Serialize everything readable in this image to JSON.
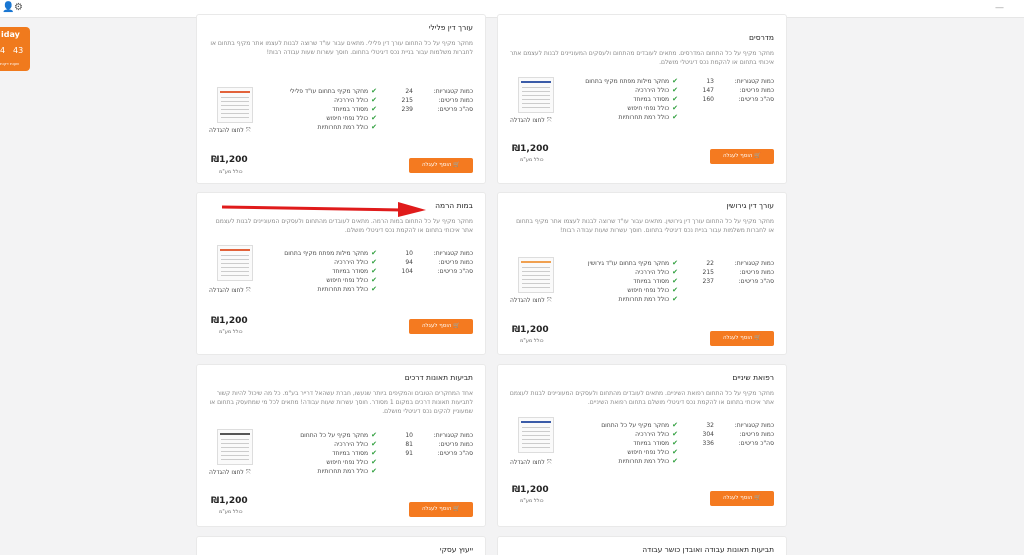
{
  "topbar": {
    "icon_left": "user-icon",
    "icon_settings": "gear-icon",
    "dash": "—"
  },
  "friday": {
    "day": "iday",
    "num1": "4",
    "num2": "43",
    "labels": "שעות   דקות"
  },
  "common": {
    "cart_label": "🛒 הוסף לעגלה",
    "zoom_label": "לחצו להגדלה",
    "price": "₪1,200",
    "unit": "כולל מע\"מ"
  },
  "cards": [
    {
      "title": "עורך דין פלילי",
      "desc": "מחקר מקיף על כל התחום עורך דין פלילי. מתאים עבור עו\"ד שרוצה לבנות לעצמו אתר מקיף בתחום או לחברות משלמות עבור בניית נכס דיגיטלי בתחום. חוסך עשרות שעות עבודה רבות!",
      "stats": [
        {
          "k": "כמות קטגוריות:",
          "v": "24"
        },
        {
          "k": "כמות פריטים:",
          "v": "215"
        },
        {
          "k": "סה\"כ פריטים:",
          "v": "239"
        }
      ],
      "features": [
        "מחקר מקיף בתחום עו\"ד פלילי",
        "כולל היררכיה",
        "מסודר במיוחד",
        "כולל נפחי חיפוש",
        "כולל רמת תחרותיות"
      ]
    },
    {
      "title": "מדרסים",
      "desc": "מחקר מקיף על כל התחום המדרסים. מתאים לעובדים מהתחום ולעסקים המעוניינים לבנות לעצמם אתר איכותי בתחום או להקמת נכס דיגיטלי מושלם.",
      "stats": [
        {
          "k": "כמות קטגוריות:",
          "v": "13"
        },
        {
          "k": "כמות פריטים:",
          "v": "147"
        },
        {
          "k": "סה\"כ פריטים:",
          "v": "160"
        }
      ],
      "features": [
        "מחקר מילות מפתח מקיף בתחום",
        "כולל היררכיה",
        "מסודר במיוחד",
        "כולל נפחי חיפוש",
        "כולל רמת תחרותיות"
      ]
    },
    {
      "title": "במות הרמה",
      "desc": "מחקר מקיף על כל התחום במות הרמה. מתאים לעובדים מהתחום ולעסקים המעוניינים לבנות לעצמם אתר איכותי בתחום או להקמת נכס דיגיטלי מושלם.",
      "stats": [
        {
          "k": "כמות קטגוריות:",
          "v": "10"
        },
        {
          "k": "כמות פריטים:",
          "v": "94"
        },
        {
          "k": "סה\"כ פריטים:",
          "v": "104"
        }
      ],
      "features": [
        "מחקר מילות מפתח מקיף בתחום",
        "כולל היררכיה",
        "מסודר במיוחד",
        "כולל נפחי חיפוש",
        "כולל רמת תחרותיות"
      ]
    },
    {
      "title": "עורך דין גירושין",
      "desc": "מחקר מקיף על כל התחום עורך דין גירושין. מתאים עבור עו\"ד שרוצה לבנות לעצמו אתר מקיף בתחום או לחברות משלמות עבור בניית נכס דיגיטלי בתחום. חוסך עשרות שעות עבודה רבות!",
      "stats": [
        {
          "k": "כמות קטגוריות:",
          "v": "22"
        },
        {
          "k": "כמות פריטים:",
          "v": "215"
        },
        {
          "k": "סה\"כ פריטים:",
          "v": "237"
        }
      ],
      "features": [
        "מחקר מקיף בתחום עו\"ד גירושין",
        "כולל היררכיה",
        "מסודר במיוחד",
        "כולל נפחי חיפוש",
        "כולל רמת תחרותיות"
      ]
    },
    {
      "title": "תביעות תאונות דרכים",
      "desc": "אחד המחקרים הטובים והמקיפים ביותר שנעשו, חברת עשהאל דרייר בע\"מ. כל מה שיכול להיות קשור לתביעות תאונות דרכים במקום 1 מסודר. חוסך עשרות שעות עבודה! מתאים לכל מי שמתעסק בתחום או שמעוניין להקים נכס דיגיטלי מושלם.",
      "stats": [
        {
          "k": "כמות קטגוריות:",
          "v": "10"
        },
        {
          "k": "כמות פריטים:",
          "v": "81"
        },
        {
          "k": "סה\"כ פריטים:",
          "v": "91"
        }
      ],
      "features": [
        "מחקר מקיף על כל התחום",
        "כולל היררכיה",
        "מסודר במיוחד",
        "כולל נפחי חיפוש",
        "כולל רמת תחרותיות"
      ]
    },
    {
      "title": "רפואת שיניים",
      "desc": "מחקר מקיף על כל התחום רפואת השיניים. מתאים לעובדים מהתחום ולעסקים המעוניינים לבנות לעצמם אתר איכותי בתחום או להקמת נכס דיגיטלי מושלם בתחום רפואת השיניים.",
      "stats": [
        {
          "k": "כמות קטגוריות:",
          "v": "32"
        },
        {
          "k": "כמות פריטים:",
          "v": "304"
        },
        {
          "k": "סה\"כ פריטים:",
          "v": "336"
        }
      ],
      "features": [
        "מחקר מקיף על כל התחום",
        "כולל היררכיה",
        "מסודר במיוחד",
        "כולל נפחי חיפוש",
        "כולל רמת תחרותיות"
      ]
    },
    {
      "title": "ייעוץ עסקי"
    },
    {
      "title": "תביעות תאונות עבודה ואובדן כושר עבודה"
    }
  ]
}
